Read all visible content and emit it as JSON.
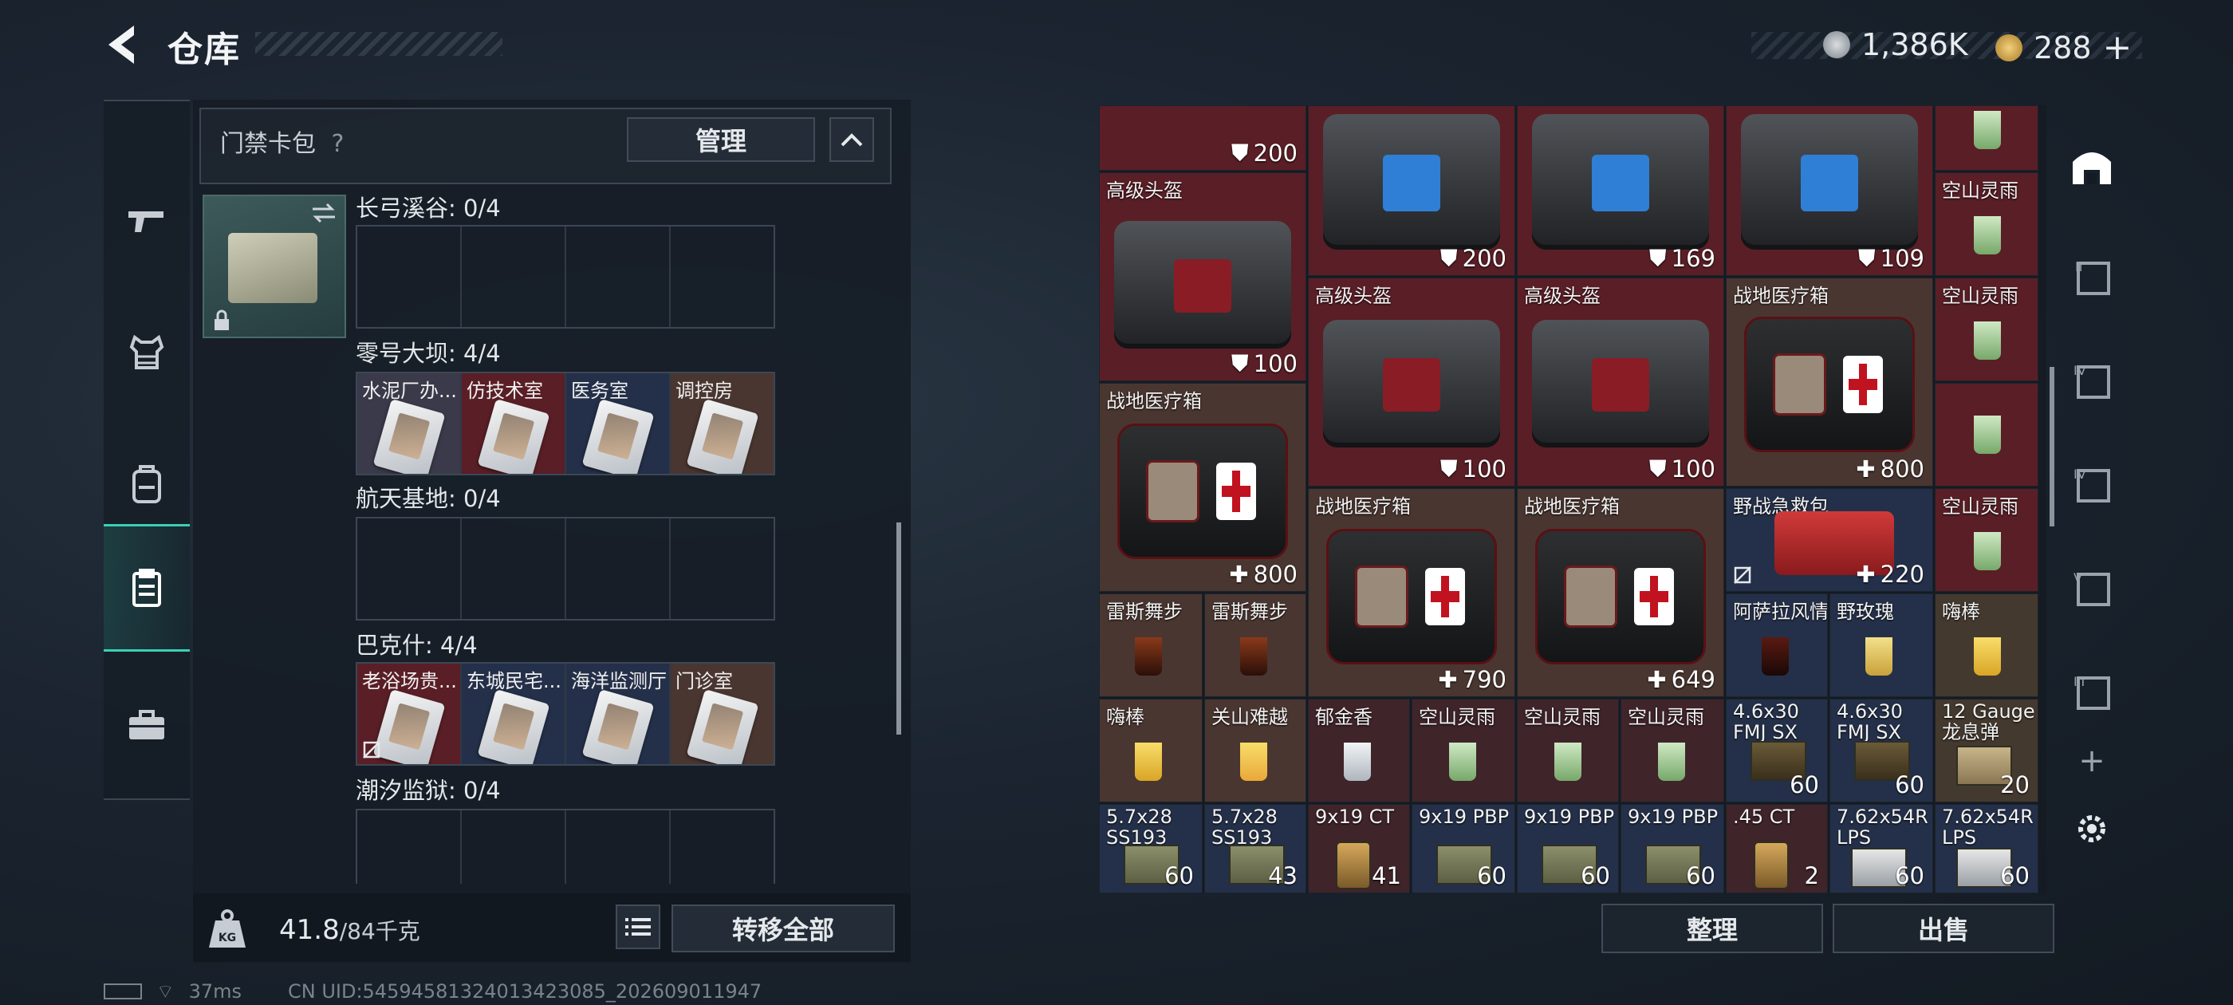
{
  "header": {
    "title": "仓库",
    "currency": [
      {
        "icon": "silver-coin-icon",
        "value": "1,386K"
      },
      {
        "icon": "gold-coin-icon",
        "value": "288"
      }
    ],
    "add_label": "+"
  },
  "left_nav": {
    "items": [
      "weapon-icon",
      "armor-vest-icon",
      "backpack-icon",
      "keycard-case-icon",
      "briefcase-icon"
    ],
    "active_index": 3
  },
  "keycard_pack": {
    "title": "门禁卡包",
    "help": "?",
    "manage_label": "管理",
    "regions": [
      {
        "label": "长弓溪谷: 0/4",
        "cards": []
      },
      {
        "label": "零号大坝: 4/4",
        "cards": [
          {
            "name": "水泥厂办...",
            "bg": "#3a3a4a"
          },
          {
            "name": "仿技术室",
            "bg": "#5a1e26"
          },
          {
            "name": "医务室",
            "bg": "#243049"
          },
          {
            "name": "调控房",
            "bg": "#4a3630"
          }
        ]
      },
      {
        "label": "航天基地: 0/4",
        "cards": []
      },
      {
        "label": "巴克什: 4/4",
        "cards": [
          {
            "name": "老浴场贵...",
            "bg": "#5a1e26"
          },
          {
            "name": "东城民宅...",
            "bg": "#243049"
          },
          {
            "name": "海洋监测厅",
            "bg": "#243049"
          },
          {
            "name": "门诊室",
            "bg": "#4a3630"
          }
        ]
      },
      {
        "label": "潮汐监狱: 0/4",
        "cards": []
      }
    ]
  },
  "footer_left": {
    "weight_icon_label": "KG",
    "weight_current": "41.8",
    "weight_max": "/84千克",
    "transfer_all_label": "转移全部"
  },
  "status": {
    "ping": "37ms",
    "uid": "CN UID:54594581324013423085_202609011947"
  },
  "inventory": {
    "rows": [
      [
        {
          "name": "",
          "val": "200",
          "type": "armor",
          "bg": "red"
        },
        {
          "name": "",
          "val": "200",
          "type": "armor",
          "bg": "red"
        },
        {
          "name": "",
          "val": "169",
          "type": "armor",
          "bg": "red"
        },
        {
          "name": "",
          "val": "109",
          "type": "armor",
          "bg": "red"
        }
      ]
    ],
    "helmet_label": "高级头盔",
    "medkit_label": "战地医疗箱",
    "firstaid_label": "野战急救包",
    "items": {
      "h1": {
        "name": "",
        "val": "200"
      },
      "h2": {
        "name": "",
        "val": "200"
      },
      "h3": {
        "name": "",
        "val": "169"
      },
      "h4": {
        "name": "",
        "val": "109"
      },
      "h5": {
        "name": "高级头盔",
        "val": "100"
      },
      "h6": {
        "name": "高级头盔",
        "val": "100"
      },
      "h7": {
        "name": "高级头盔",
        "val": "100"
      },
      "m1": {
        "name": "战地医疗箱",
        "val": "800"
      },
      "m2": {
        "name": "战地医疗箱",
        "val": "800"
      },
      "m3": {
        "name": "战地医疗箱",
        "val": "790"
      },
      "m4": {
        "name": "战地医疗箱",
        "val": "649"
      },
      "fa": {
        "name": "野战急救包",
        "val": "220"
      },
      "d1": {
        "name": "空山灵雨"
      },
      "d2": {
        "name": "空山灵雨"
      },
      "d3": {
        "name": "空山灵雨"
      },
      "d4": {
        "name": "雷斯舞步"
      },
      "d5": {
        "name": "雷斯舞步"
      },
      "d6": {
        "name": "阿萨拉风情"
      },
      "d7": {
        "name": "野玫瑰"
      },
      "d8": {
        "name": "嗨棒"
      },
      "d9": {
        "name": "嗨棒"
      },
      "d10": {
        "name": "关山难越"
      },
      "d11": {
        "name": "郁金香"
      },
      "d12": {
        "name": "空山灵雨"
      },
      "d13": {
        "name": "空山灵雨"
      },
      "d14": {
        "name": "空山灵雨"
      },
      "a1": {
        "name": "4.6x30 FMJ SX",
        "val": "60"
      },
      "a2": {
        "name": "4.6x30 FMJ SX",
        "val": "60"
      },
      "a3": {
        "name": "12 Gauge 龙息弹",
        "val": "20"
      },
      "a4": {
        "name": "5.7x28 SS193",
        "val": "60"
      },
      "a5": {
        "name": "5.7x28 SS193",
        "val": "43"
      },
      "a6": {
        "name": "9x19 CT",
        "val": "41"
      },
      "a7": {
        "name": "9x19 PBP",
        "val": "60"
      },
      "a8": {
        "name": "9x19 PBP",
        "val": "60"
      },
      "a9": {
        "name": "9x19 PBP",
        "val": "60"
      },
      "a10": {
        "name": ".45 CT",
        "val": "2"
      },
      "a11": {
        "name": "7.62x54R LPS",
        "val": "60"
      },
      "a12": {
        "name": "7.62x54R LPS",
        "val": "60"
      }
    }
  },
  "right_rail": {
    "items": [
      "home-base-icon",
      "tier-II-icon",
      "tier-IV-icon",
      "tier-IV-b-icon",
      "tier-V-icon",
      "tier-III-icon",
      "add-icon",
      "settings-icon"
    ]
  },
  "footer_right": {
    "sort_label": "整理",
    "sell_label": "出售"
  },
  "colors": {
    "accent": "#3ad0b5",
    "red_tier": "#5a1e26",
    "blue_tier": "#243049",
    "brown_tier": "#4a3630"
  }
}
